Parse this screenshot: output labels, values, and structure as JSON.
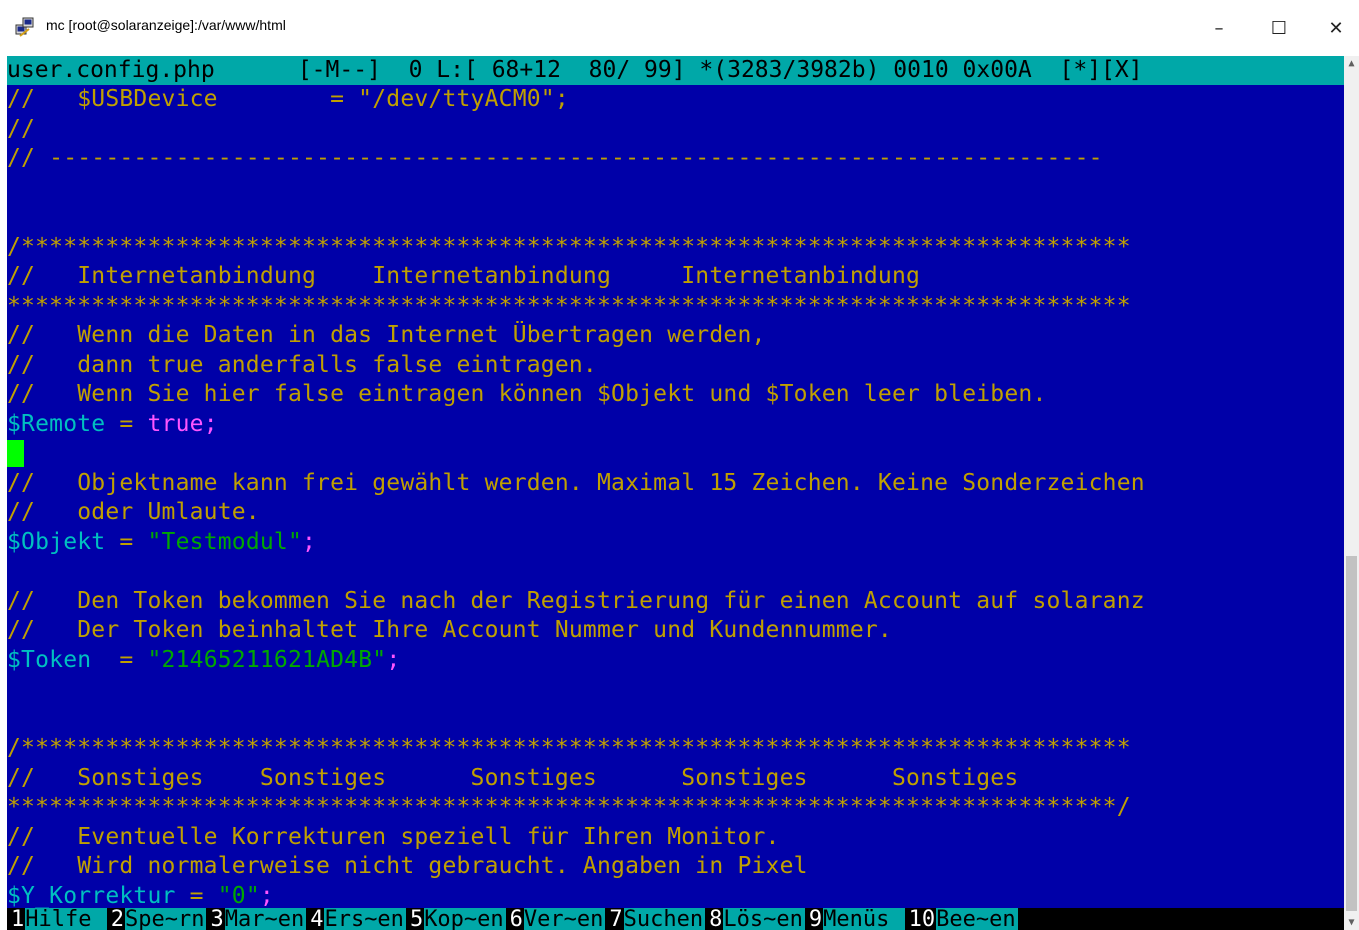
{
  "window": {
    "title": "mc [root@solaranzeige]:/var/www/html",
    "minimize_glyph": "–",
    "maximize_glyph": "☐",
    "close_glyph": "✕"
  },
  "editor": {
    "status": {
      "filename": "user.config.php",
      "mode": "[-M--]",
      "position": "0 L:[ 68+12  80/ 99]",
      "bytes": "*(3283/3982b)",
      "char_dec": "0010",
      "char_hex": "0x00A",
      "flags": "[*][X]"
    },
    "lines": [
      [
        {
          "t": "//   $USBDevice        = \"/dev/ttyACM0\";",
          "c": "comment"
        }
      ],
      [
        {
          "t": "//",
          "c": "comment"
        }
      ],
      [
        {
          "t": "// ---------------------------------------------------------------------------",
          "c": "comment"
        }
      ],
      [],
      [],
      [
        {
          "t": "/*******************************************************************************",
          "c": "comment"
        }
      ],
      [
        {
          "t": "//   Internetanbindung    Internetanbindung     Internetanbindung",
          "c": "comment"
        }
      ],
      [
        {
          "t": "********************************************************************************",
          "c": "comment"
        }
      ],
      [
        {
          "t": "//   Wenn die Daten in das Internet Übertragen werden,",
          "c": "comment"
        }
      ],
      [
        {
          "t": "//   dann true anderfalls false eintragen.",
          "c": "comment"
        }
      ],
      [
        {
          "t": "//   Wenn Sie hier false eintragen können $Objekt und $Token leer bleiben.",
          "c": "comment"
        }
      ],
      [
        {
          "t": "$Remote",
          "c": "var"
        },
        {
          "t": " = ",
          "c": "op"
        },
        {
          "t": "true",
          "c": "kw"
        },
        {
          "t": ";",
          "c": "semi"
        }
      ],
      [
        {
          "t": "",
          "c": "cursor"
        }
      ],
      [
        {
          "t": "//   Objektname kann frei gewählt werden. Maximal 15 Zeichen. Keine Sonderzeichen",
          "c": "comment"
        }
      ],
      [
        {
          "t": "//   oder Umlaute.",
          "c": "comment"
        }
      ],
      [
        {
          "t": "$Objekt",
          "c": "var"
        },
        {
          "t": " = ",
          "c": "op"
        },
        {
          "t": "\"Testmodul\"",
          "c": "str"
        },
        {
          "t": ";",
          "c": "semi"
        }
      ],
      [],
      [
        {
          "t": "//   Den Token bekommen Sie nach der Registrierung für einen Account auf solaranz",
          "c": "comment"
        }
      ],
      [
        {
          "t": "//   Der Token beinhaltet Ihre Account Nummer und Kundennummer.",
          "c": "comment"
        }
      ],
      [
        {
          "t": "$Token",
          "c": "var"
        },
        {
          "t": "  = ",
          "c": "op"
        },
        {
          "t": "\"21465211621AD4B\"",
          "c": "str"
        },
        {
          "t": ";",
          "c": "semi"
        }
      ],
      [],
      [],
      [
        {
          "t": "/*******************************************************************************",
          "c": "comment"
        }
      ],
      [
        {
          "t": "//   Sonstiges    Sonstiges      Sonstiges      Sonstiges      Sonstiges",
          "c": "comment"
        }
      ],
      [
        {
          "t": "*******************************************************************************/",
          "c": "comment"
        }
      ],
      [
        {
          "t": "//   Eventuelle Korrekturen speziell für Ihren Monitor.",
          "c": "comment"
        }
      ],
      [
        {
          "t": "//   Wird normalerweise nicht gebraucht. Angaben in Pixel",
          "c": "comment"
        }
      ],
      [
        {
          "t": "$Y_Korrektur",
          "c": "var"
        },
        {
          "t": " = ",
          "c": "op"
        },
        {
          "t": "\"0\"",
          "c": "str"
        },
        {
          "t": ";",
          "c": "semi"
        }
      ]
    ]
  },
  "function_keys": [
    {
      "num": "1",
      "label": "Hilfe "
    },
    {
      "num": "2",
      "label": "Spe~rn"
    },
    {
      "num": "3",
      "label": "Mar~en"
    },
    {
      "num": "4",
      "label": "Ers~en"
    },
    {
      "num": "5",
      "label": "Kop~en"
    },
    {
      "num": "6",
      "label": "Ver~en"
    },
    {
      "num": "7",
      "label": "Suchen"
    },
    {
      "num": "8",
      "label": "Lös~en"
    },
    {
      "num": "9",
      "label": "Menüs "
    },
    {
      "num": "10",
      "label": "Bee~en"
    }
  ],
  "colors": {
    "background": "#0000a8",
    "status_bar": "#00a8a8",
    "comment": "#c0a000",
    "variable": "#00c0c0",
    "keyword": "#ff55ff",
    "string": "#00a800",
    "cursor": "#00ff00"
  }
}
